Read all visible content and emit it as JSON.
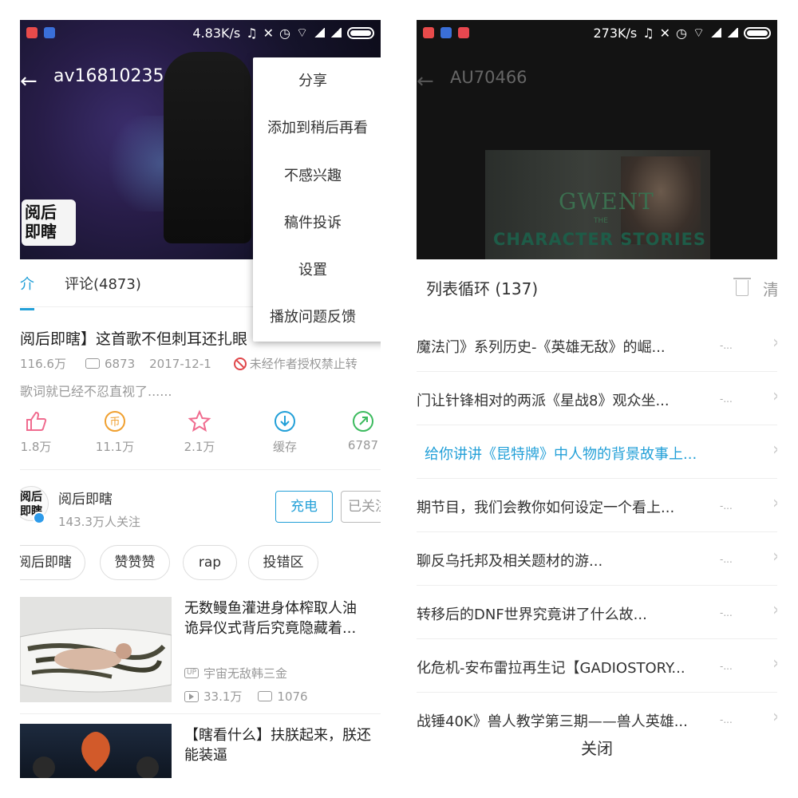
{
  "left": {
    "status": {
      "speed": "4.83K/s"
    },
    "video_id": "av16810235",
    "tabs": {
      "intro": "介",
      "comments": "评论(4873)"
    },
    "video_title": "阅后即瞎】这首歌不但刺耳还扎眼",
    "meta": {
      "plays": "116.6万",
      "danmaku": "6873",
      "date": "2017-12-1",
      "warning": "未经作者授权禁止转"
    },
    "description": "歌词就已经不忍直视了......",
    "actions": [
      {
        "icon": "thumbs-up-icon",
        "label": "1.8万",
        "color": "#f06c8f"
      },
      {
        "icon": "coin-icon",
        "label": "11.1万",
        "color": "#f0a030"
      },
      {
        "icon": "star-icon",
        "label": "2.1万",
        "color": "#f06c8f"
      },
      {
        "icon": "download-icon",
        "label": "缓存",
        "color": "#23a0d8"
      },
      {
        "icon": "share-icon",
        "label": "6787",
        "color": "#3dbb5f"
      }
    ],
    "uploader": {
      "name": "阅后即瞎",
      "fans": "143.3万人关注",
      "charge": "充电",
      "follow": "已关注"
    },
    "tags": [
      "阅后即瞎",
      "赞赞赞",
      "rap",
      "投错区"
    ],
    "recommendations": [
      {
        "title_line1": "无数鳗鱼灌进身体榨取人油",
        "title_line2": "诡异仪式背后究竟隐藏着...",
        "owner": "宇宙无敌韩三金",
        "plays": "33.1万",
        "danmaku": "1076"
      },
      {
        "title_line1": "【瞎看什么】扶朕起来，朕还",
        "title_line2": "能装逼"
      }
    ],
    "menu": [
      "分享",
      "添加到稍后再看",
      "不感兴趣",
      "稿件投诉",
      "设置",
      "播放问题反馈"
    ]
  },
  "right": {
    "status": {
      "speed": "273K/s"
    },
    "audio_id": "AU70466",
    "poster": {
      "brand": "GWENT",
      "sub": "THE",
      "caption": "CHARACTER STORIES"
    },
    "playlist": {
      "title": "列表循环 (137)",
      "clear": "清",
      "items": [
        {
          "text": "魔法门》系列历史-《英雄无敌》的崛...",
          "dash": "-..."
        },
        {
          "text": "门让针锋相对的两派《星战8》观众坐...",
          "dash": "-..."
        },
        {
          "text": "给你讲讲《昆特牌》中人物的背景故事上...",
          "dash": "",
          "active": true
        },
        {
          "text": "期节目，我们会教你如何设定一个看上...",
          "dash": "-..."
        },
        {
          "text": "聊反乌托邦及相关题材的游...",
          "dash": "-..."
        },
        {
          "text": "转移后的DNF世界究竟讲了什么故...",
          "dash": "-..."
        },
        {
          "text": "化危机-安布雷拉再生记【GADIOSTORY...",
          "dash": "-..."
        },
        {
          "text": "战锤40K》兽人教学第三期——兽人英雄...",
          "dash": "-..."
        }
      ],
      "close": "关闭"
    }
  }
}
